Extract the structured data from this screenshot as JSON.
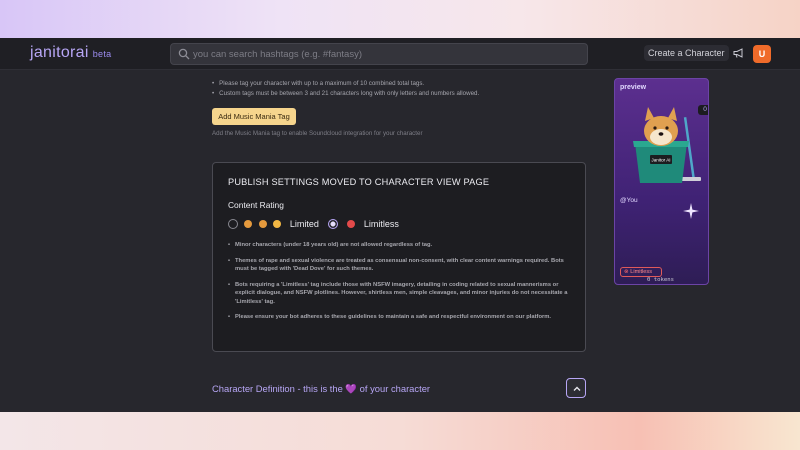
{
  "app": {
    "logo": "janitorai",
    "beta": "beta"
  },
  "search": {
    "placeholder": "you can search hashtags (e.g. #fantasy)"
  },
  "header": {
    "create_label": "Create a Character",
    "avatar_letter": "U"
  },
  "tags": {
    "bullets": [
      "Please tag your character with up to a maximum of 10 combined total tags.",
      "Custom tags must be between 3 and 21 characters long with only letters and numbers allowed."
    ],
    "music_button": "Add Music Mania Tag",
    "music_help": "Add the Music Mania tag to enable Soundcloud integration for your character"
  },
  "publish": {
    "title": "PUBLISH SETTINGS MOVED TO CHARACTER VIEW PAGE",
    "content_rating_label": "Content Rating",
    "options": [
      {
        "label": "Limited",
        "selected": false
      },
      {
        "label": "Limitless",
        "selected": true
      }
    ],
    "rules": [
      "Minor characters (under 18 years old) are not allowed regardless of tag.",
      "Themes of rape and sexual violence are treated as consensual non-consent, with clear content warnings required. Bots must be tagged with 'Dead Dove' for such themes.",
      "Bots requiring a 'Limitless' tag include those with NSFW imagery, detailing in coding related to sexual mannerisms or explicit dialogue, and NSFW plotlines. However, shirtless men, simple cleavages, and minor injuries do not necessitate a 'Limitless' tag.",
      "Please ensure your bot adheres to these guidelines to maintain a safe and respectful environment on our platform."
    ]
  },
  "char_def": {
    "text_before": "Character Definition - this is the ",
    "heart": "💜",
    "text_after": " of your character"
  },
  "preview": {
    "label": "preview",
    "badge": "0",
    "bucket_label": "Janitor AI",
    "user": "@You",
    "tag": "Limitless",
    "tokens": "0 tokens"
  },
  "colors": {
    "accent": "#b7a6f5",
    "background": "#27272d",
    "topbar": "#1f1f24",
    "music_button": "#f6d58d",
    "avatar": "#f06b2a"
  }
}
